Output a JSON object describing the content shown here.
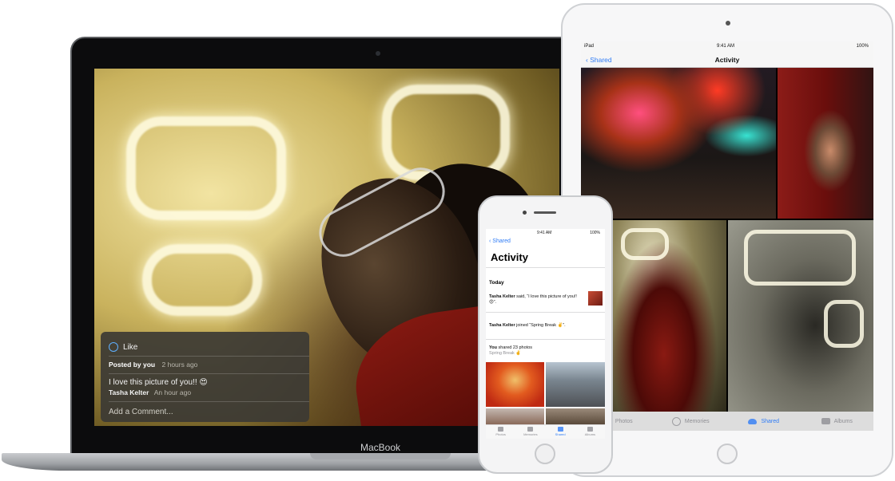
{
  "macbook": {
    "brand": "MacBook",
    "panel": {
      "like_label": "Like",
      "posted_by_prefix": "Posted by",
      "posted_by_name": "you",
      "posted_time": "2 hours ago",
      "comment_text": "I love this picture of you!! 😍",
      "comment_author": "Tasha Kelter",
      "comment_time": "An hour ago",
      "add_comment_placeholder": "Add a Comment..."
    }
  },
  "ipad": {
    "status": {
      "carrier": "iPad",
      "time": "9:41 AM",
      "battery": "100%"
    },
    "nav": {
      "back_label": "Shared",
      "title": "Activity"
    },
    "tabs": [
      {
        "label": "Photos",
        "icon": "photos-icon"
      },
      {
        "label": "Memories",
        "icon": "memories-icon"
      },
      {
        "label": "Shared",
        "icon": "cloud-icon",
        "active": true
      },
      {
        "label": "Albums",
        "icon": "albums-icon"
      }
    ]
  },
  "iphone": {
    "status": {
      "time": "9:41 AM",
      "battery": "100%"
    },
    "nav": {
      "back_label": "Shared",
      "title": "Activity"
    },
    "section": "Today",
    "items": [
      {
        "name": "Tasha Kelter",
        "text": " said, “I love this picture of you!! 😍”."
      },
      {
        "name": "Tasha Kelter",
        "text": " joined “Spring Break ✌️”."
      },
      {
        "name": "You",
        "text": " shared 23 photos",
        "sub": "Spring Break ✌️"
      }
    ],
    "tabs": [
      {
        "label": "Photos"
      },
      {
        "label": "Memories"
      },
      {
        "label": "Shared",
        "active": true
      },
      {
        "label": "Albums"
      }
    ]
  },
  "colors": {
    "accent": "#2f7cf6",
    "panel_bg": "#3c3a34"
  }
}
